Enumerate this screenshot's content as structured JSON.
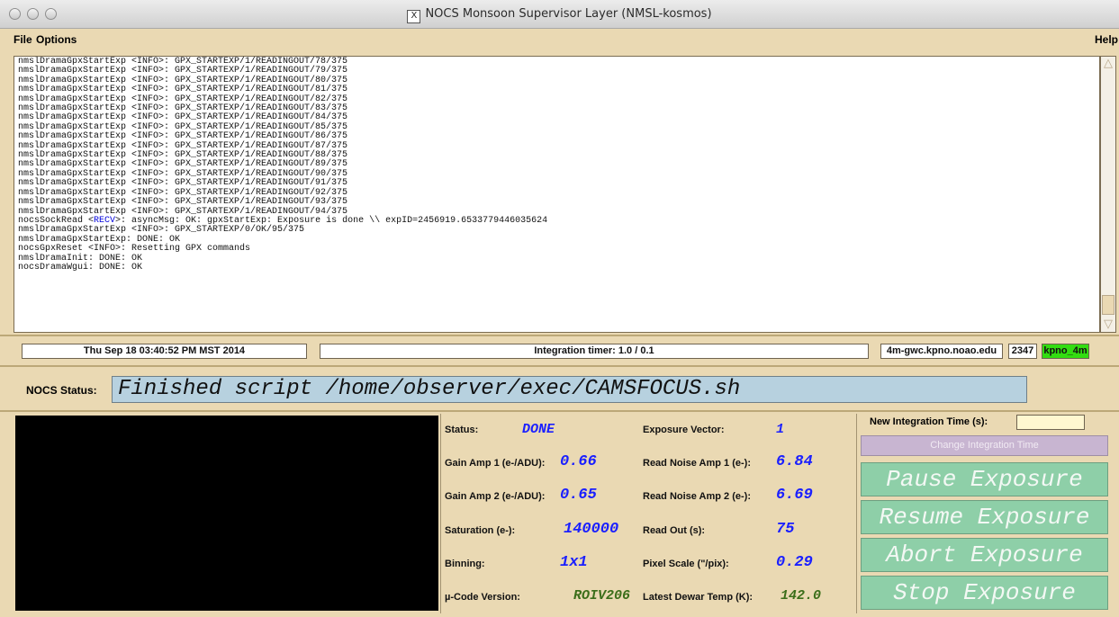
{
  "window": {
    "title": "NOCS Monsoon Supervisor Layer (NMSL-kosmos)",
    "x_glyph": "X"
  },
  "menubar": {
    "file": "File",
    "options": "Options",
    "help": "Help"
  },
  "log": {
    "lines": [
      "nmslDramaGpxStartExp <INFO>: GPX_STARTEXP/1/READINGOUT/78/375",
      "nmslDramaGpxStartExp <INFO>: GPX_STARTEXP/1/READINGOUT/79/375",
      "nmslDramaGpxStartExp <INFO>: GPX_STARTEXP/1/READINGOUT/80/375",
      "nmslDramaGpxStartExp <INFO>: GPX_STARTEXP/1/READINGOUT/81/375",
      "nmslDramaGpxStartExp <INFO>: GPX_STARTEXP/1/READINGOUT/82/375",
      "nmslDramaGpxStartExp <INFO>: GPX_STARTEXP/1/READINGOUT/83/375",
      "nmslDramaGpxStartExp <INFO>: GPX_STARTEXP/1/READINGOUT/84/375",
      "nmslDramaGpxStartExp <INFO>: GPX_STARTEXP/1/READINGOUT/85/375",
      "nmslDramaGpxStartExp <INFO>: GPX_STARTEXP/1/READINGOUT/86/375",
      "nmslDramaGpxStartExp <INFO>: GPX_STARTEXP/1/READINGOUT/87/375",
      "nmslDramaGpxStartExp <INFO>: GPX_STARTEXP/1/READINGOUT/88/375",
      "nmslDramaGpxStartExp <INFO>: GPX_STARTEXP/1/READINGOUT/89/375",
      "nmslDramaGpxStartExp <INFO>: GPX_STARTEXP/1/READINGOUT/90/375",
      "nmslDramaGpxStartExp <INFO>: GPX_STARTEXP/1/READINGOUT/91/375",
      "nmslDramaGpxStartExp <INFO>: GPX_STARTEXP/1/READINGOUT/92/375",
      "nmslDramaGpxStartExp <INFO>: GPX_STARTEXP/1/READINGOUT/93/375",
      "nmslDramaGpxStartExp <INFO>: GPX_STARTEXP/1/READINGOUT/94/375"
    ],
    "recv_prefix": "nocsSockRead <",
    "recv_tag": "RECV",
    "recv_suffix": ">: asyncMsg: OK: gpxStartExp: Exposure is done \\\\ expID=2456919.6533779446035624",
    "tail": [
      "nmslDramaGpxStartExp <INFO>: GPX_STARTEXP/0/OK/95/375",
      "nmslDramaGpxStartExp: DONE: OK",
      "nocsGpxReset <INFO>: Resetting GPX commands",
      "nmslDramaInit: DONE: OK",
      "nocsDramaWgui: DONE: OK"
    ]
  },
  "statusbar": {
    "datetime": "Thu Sep 18 03:40:52 PM MST 2014",
    "integration_timer": "Integration timer: 1.0 / 0.1",
    "host": "4m-gwc.kpno.noao.edu",
    "port": "2347",
    "instance": "kpno_4m",
    "instance_color": "#33dd11"
  },
  "nocs": {
    "label": "NOCS Status:",
    "status": "Finished script /home/observer/exec/CAMSFOCUS.sh"
  },
  "params": {
    "status_label": "Status:",
    "status_value": "DONE",
    "exp_vector_label": "Exposure Vector:",
    "exp_vector_value": "1",
    "gain1_label": "Gain Amp 1 (e-/ADU):",
    "gain1_value": "0.66",
    "rn1_label": "Read Noise Amp 1 (e-):",
    "rn1_value": "6.84",
    "gain2_label": "Gain Amp 2 (e-/ADU):",
    "gain2_value": "0.65",
    "rn2_label": "Read Noise Amp 2 (e-):",
    "rn2_value": "6.69",
    "sat_label": "Saturation (e-):",
    "sat_value": "140000",
    "readout_label": "Read Out (s):",
    "readout_value": "75",
    "binning_label": "Binning:",
    "binning_value": "1x1",
    "pixscale_label": "Pixel Scale (\"/pix):",
    "pixscale_value": "0.29",
    "ucode_label": "µ-Code Version:",
    "ucode_value": "ROIV206",
    "dewar_label": "Latest Dewar Temp (K):",
    "dewar_value": "142.0"
  },
  "controls": {
    "new_int_label": "New Integration Time (s):",
    "new_int_value": "",
    "change_label": "Change Integration Time",
    "pause_label": "Pause Exposure",
    "resume_label": "Resume Exposure",
    "abort_label": "Abort Exposure",
    "stop_label": "Stop Exposure"
  }
}
